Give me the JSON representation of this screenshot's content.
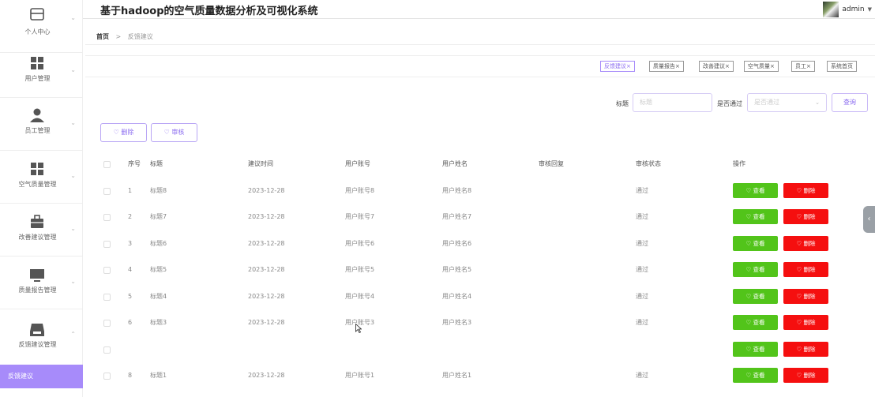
{
  "app": {
    "title": "基于hadoop的空气质量数据分析及可视化系统",
    "user": "admin"
  },
  "sidebar": {
    "items": [
      {
        "label": "个人中心",
        "icon": "window-icon"
      },
      {
        "label": "用户管理",
        "icon": "grid-icon"
      },
      {
        "label": "员工管理",
        "icon": "person-icon"
      },
      {
        "label": "空气质量管理",
        "icon": "grid-icon"
      },
      {
        "label": "改善建议管理",
        "icon": "briefcase-icon"
      },
      {
        "label": "质量报告管理",
        "icon": "monitor-icon"
      },
      {
        "label": "反馈建议管理",
        "icon": "tray-icon"
      }
    ],
    "active_sub": "反馈建议"
  },
  "breadcrumb": {
    "home": "首页",
    "sep": ">",
    "current": "反馈建议"
  },
  "tags": [
    "反馈建议×",
    "质量报告×",
    "改善建议×",
    "空气质量×",
    "员工×",
    "系统首页"
  ],
  "search": {
    "title_label": "标题",
    "title_placeholder": "标题",
    "pass_label": "是否通过",
    "pass_placeholder": "是否通过",
    "button": "查询"
  },
  "actions": {
    "delete": "♡ 删除",
    "audit": "♡ 审核"
  },
  "table": {
    "headers": [
      "序号",
      "标题",
      "建议时间",
      "用户账号",
      "用户姓名",
      "审核回复",
      "审核状态",
      "操作"
    ],
    "rows": [
      {
        "no": "1",
        "title": "标题8",
        "time": "2023-12-28",
        "account": "用户账号8",
        "name": "用户姓名8",
        "reply": "",
        "status": "通过"
      },
      {
        "no": "2",
        "title": "标题7",
        "time": "2023-12-28",
        "account": "用户账号7",
        "name": "用户姓名7",
        "reply": "",
        "status": "通过"
      },
      {
        "no": "3",
        "title": "标题6",
        "time": "2023-12-28",
        "account": "用户账号6",
        "name": "用户姓名6",
        "reply": "",
        "status": "通过"
      },
      {
        "no": "4",
        "title": "标题5",
        "time": "2023-12-28",
        "account": "用户账号5",
        "name": "用户姓名5",
        "reply": "",
        "status": "通过"
      },
      {
        "no": "5",
        "title": "标题4",
        "time": "2023-12-28",
        "account": "用户账号4",
        "name": "用户姓名4",
        "reply": "",
        "status": "通过"
      },
      {
        "no": "6",
        "title": "标题3",
        "time": "2023-12-28",
        "account": "用户账号3",
        "name": "用户姓名3",
        "reply": "",
        "status": "通过"
      },
      {
        "no": "",
        "title": "",
        "time": "",
        "account": "",
        "name": "",
        "reply": "",
        "status": ""
      },
      {
        "no": "8",
        "title": "标题1",
        "time": "2023-12-28",
        "account": "用户账号1",
        "name": "用户姓名1",
        "reply": "",
        "status": "通过"
      }
    ],
    "view_label": "♡ 查看",
    "del_label": "♡ 删除"
  },
  "colors": {
    "accent": "#a78bfa",
    "view": "#52c41a",
    "delete": "#f50f0f"
  }
}
